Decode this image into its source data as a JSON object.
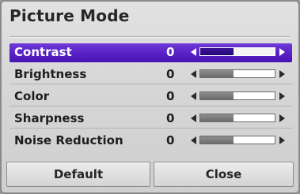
{
  "dialog": {
    "title": "Picture Mode"
  },
  "settings": [
    {
      "label": "Contrast",
      "value": "0",
      "level_percent": 45,
      "selected": true
    },
    {
      "label": "Brightness",
      "value": "0",
      "level_percent": 45,
      "selected": false
    },
    {
      "label": "Color",
      "value": "0",
      "level_percent": 45,
      "selected": false
    },
    {
      "label": "Sharpness",
      "value": "0",
      "level_percent": 45,
      "selected": false
    },
    {
      "label": "Noise Reduction",
      "value": "0",
      "level_percent": 45,
      "selected": false
    }
  ],
  "buttons": {
    "default_label": "Default",
    "close_label": "Close"
  },
  "icons": {
    "decrease": "triangle-left-icon",
    "increase": "triangle-right-icon"
  },
  "colors": {
    "selection": "#5a22c6",
    "background": "#d6d6d6",
    "text": "#1e1e1e"
  }
}
